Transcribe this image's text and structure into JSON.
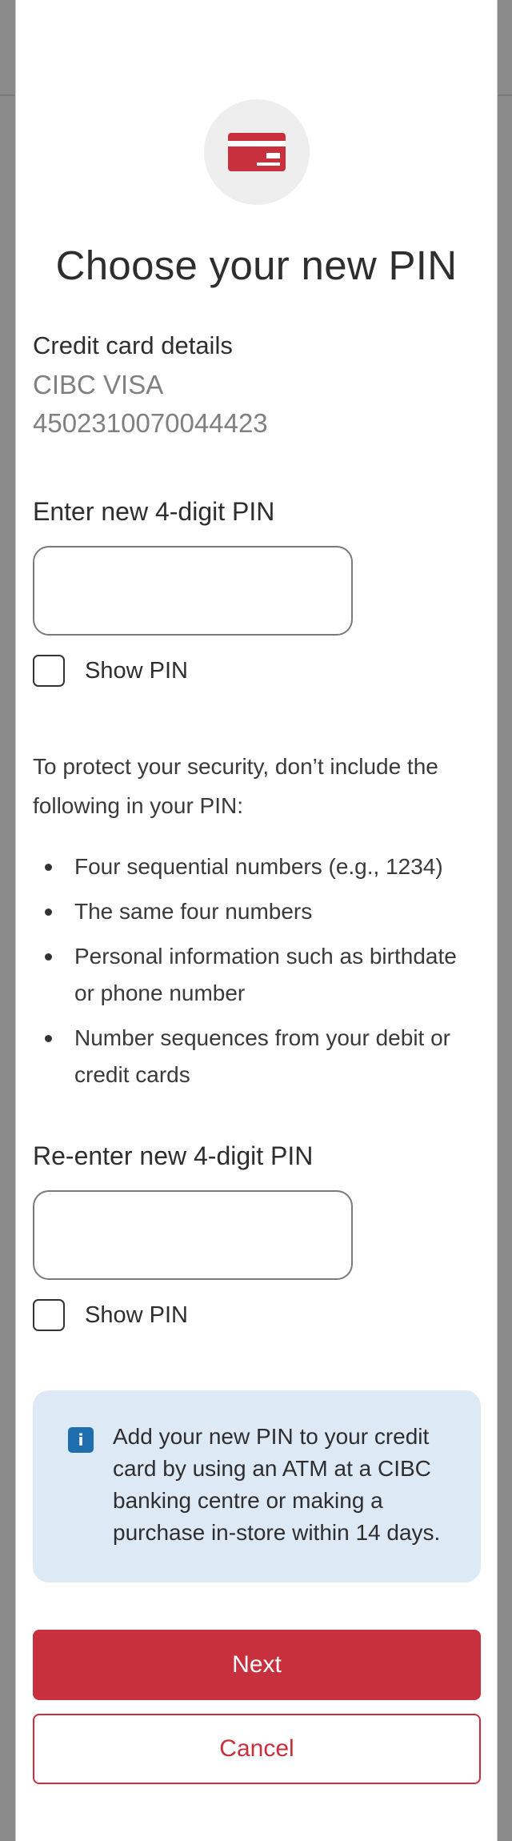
{
  "modal": {
    "icon": "credit-card-icon",
    "title": "Choose your new PIN"
  },
  "card_details": {
    "label": "Credit card details",
    "card_type": "CIBC VISA",
    "card_number": "4502310070044423"
  },
  "new_pin": {
    "label": "Enter new 4-digit PIN",
    "value": "",
    "show_pin_label": "Show PIN",
    "show_pin_checked": false
  },
  "security": {
    "intro": "To protect your security, don’t include the following in your PIN:",
    "rules": [
      "Four sequential numbers (e.g., 1234)",
      "The same four numbers",
      "Personal information such as birthdate or phone number",
      "Number sequences from your debit or credit cards"
    ]
  },
  "confirm_pin": {
    "label": "Re-enter new 4-digit PIN",
    "value": "",
    "show_pin_label": "Show PIN",
    "show_pin_checked": false
  },
  "info": {
    "icon": "info-icon",
    "icon_glyph": "i",
    "text": "Add your new PIN to your credit card by using an ATM at a CIBC banking centre or making a purchase in-store within 14 days."
  },
  "actions": {
    "next_label": "Next",
    "cancel_label": "Cancel"
  },
  "colors": {
    "brand_red": "#c8303e",
    "info_blue": "#1f6fae",
    "info_bg": "#dee9f6",
    "overlay": "#8a8a8a"
  }
}
